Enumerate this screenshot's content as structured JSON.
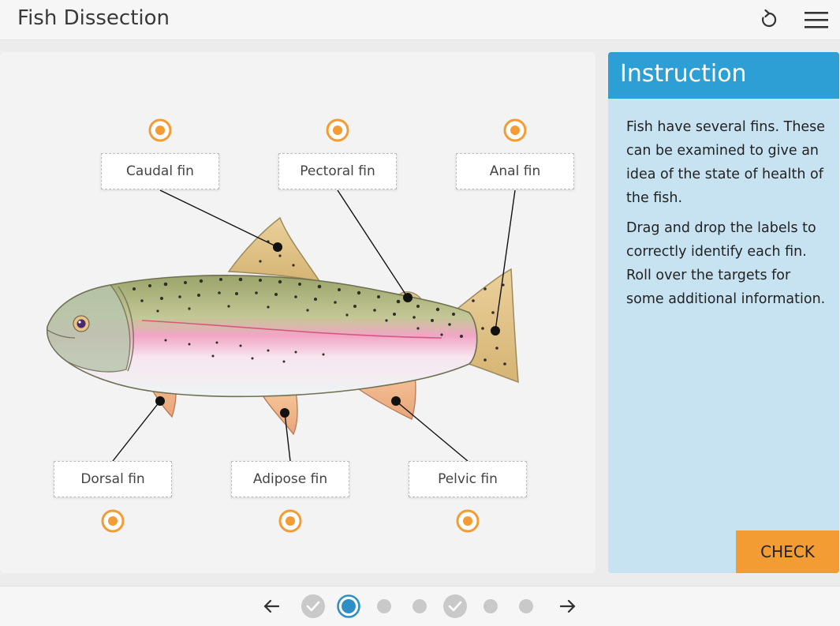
{
  "header": {
    "title": "Fish Dissection",
    "reset_icon": "reset-icon",
    "menu_icon": "hamburger-menu-icon"
  },
  "labels": {
    "top": [
      "Caudal fin",
      "Pectoral fin",
      "Anal fin"
    ],
    "bottom": [
      "Dorsal fin",
      "Adipose fin",
      "Pelvic fin"
    ]
  },
  "instruction": {
    "title": "Instruction",
    "para1": "Fish have several fins. These can be examined to give an idea of the state of health of the fish.",
    "para2": "Drag and drop the labels to correctly identify each fin. Roll over the targets for some additional information.",
    "check_label": "CHECK"
  },
  "pagination": {
    "prev_icon": "arrow-left-icon",
    "next_icon": "arrow-right-icon",
    "pages": [
      "completed",
      "current",
      "pending",
      "pending",
      "completed",
      "pending",
      "pending"
    ]
  },
  "colors": {
    "accent_orange": "#f39c33",
    "accent_blue": "#2e9fd5",
    "panel_bg": "#c7e3f2",
    "completed_dot": "#c9c9c9",
    "pending_dot": "#c9c9c9"
  }
}
